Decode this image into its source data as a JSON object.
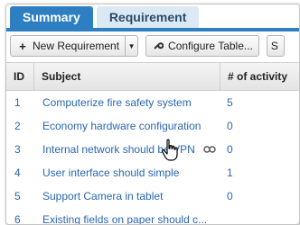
{
  "tabs": [
    {
      "label": "Summary"
    },
    {
      "label": "Requirement"
    }
  ],
  "toolbar": {
    "new_requirement": "New Requirement",
    "configure_table": "Configure Table...",
    "partial_button": "S"
  },
  "table": {
    "headers": {
      "id": "ID",
      "subject": "Subject",
      "activity": "# of activity"
    },
    "rows": [
      {
        "id": "1",
        "subject": "Computerize fire safety system",
        "activity": "5"
      },
      {
        "id": "2",
        "subject": "Economy hardware configuration",
        "activity": "0"
      },
      {
        "id": "3",
        "subject": "Internal network should be VPN",
        "activity": "0"
      },
      {
        "id": "4",
        "subject": "User interface should simple",
        "activity": "1"
      },
      {
        "id": "5",
        "subject": "Support Camera in tablet",
        "activity": "0"
      },
      {
        "id": "6",
        "subject": "Existing fields on paper should c...",
        "activity": ""
      }
    ]
  },
  "icons": {
    "new": "plus-icon",
    "configure": "wrench-icon",
    "link": "link-icon",
    "cursor": "hand-pointer-icon"
  }
}
